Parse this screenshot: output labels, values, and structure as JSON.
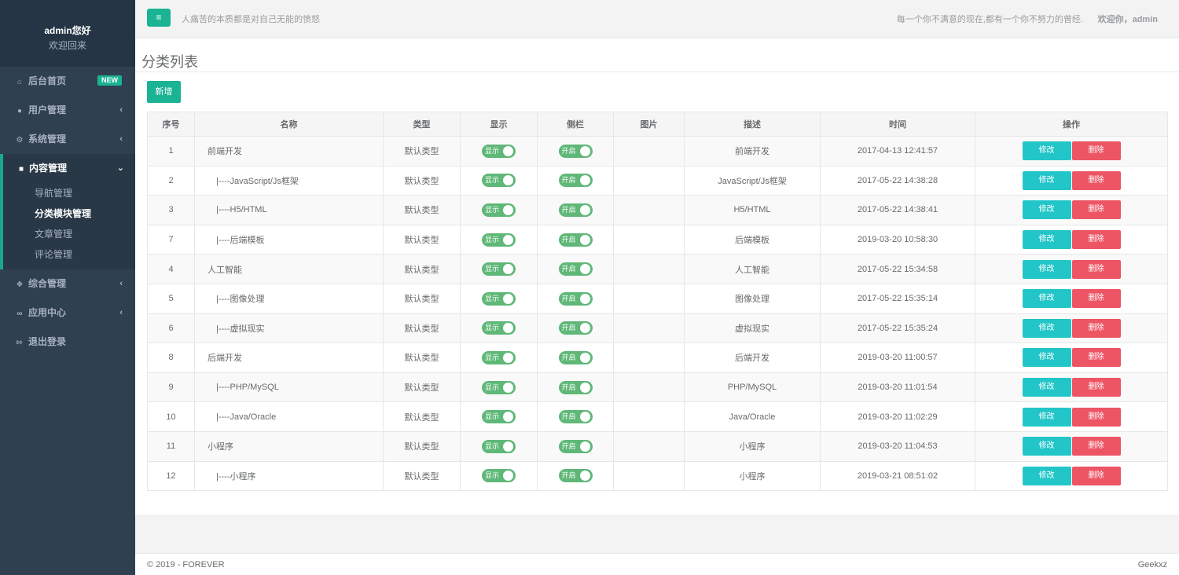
{
  "profile": {
    "name": "admin您好",
    "welcome": "欢迎回来"
  },
  "nav": {
    "items_top": [
      {
        "label": "后台首页",
        "icon": "home-icon",
        "badge": "NEW"
      },
      {
        "label": "用户管理",
        "icon": "user-icon",
        "arrow": "‹"
      },
      {
        "label": "系统管理",
        "icon": "gears-icon",
        "arrow": "‹"
      }
    ],
    "active": {
      "label": "内容管理",
      "icon": "document-icon",
      "arrow": "⌄",
      "sub": [
        "导航管理",
        "分类模块管理",
        "文章管理",
        "评论管理"
      ]
    },
    "items_bottom": [
      {
        "label": "综合管理",
        "icon": "cubes-icon",
        "arrow": "‹"
      },
      {
        "label": "应用中心",
        "icon": "link-icon",
        "arrow": "‹"
      },
      {
        "label": "退出登录",
        "icon": "logout-icon"
      }
    ]
  },
  "topbar": {
    "menu_icon": "≡",
    "slogan": "人痛苦的本质都是对自己无能的愤怒",
    "motto": "每一个你不满意的现在,都有一个你不努力的曾经.",
    "welcome": "欢迎你，admin"
  },
  "page": {
    "title": "分类列表",
    "add_label": "新增"
  },
  "table": {
    "headers": [
      "序号",
      "名称",
      "类型",
      "显示",
      "侧栏",
      "图片",
      "描述",
      "时间",
      "操作"
    ],
    "show_label": "显示",
    "sidebar_label": "开启",
    "edit_label": "修改",
    "delete_label": "删除",
    "rows": [
      {
        "id": "1",
        "name": "前端开发",
        "type": "默认类型",
        "desc": "前端开发",
        "time": "2017-04-13 12:41:57"
      },
      {
        "id": "2",
        "name": "|----JavaScript/Js框架",
        "type": "默认类型",
        "desc": "JavaScript/Js框架",
        "time": "2017-05-22 14:38:28"
      },
      {
        "id": "3",
        "name": "|----H5/HTML",
        "type": "默认类型",
        "desc": "H5/HTML",
        "time": "2017-05-22 14:38:41"
      },
      {
        "id": "7",
        "name": "|----后端模板",
        "type": "默认类型",
        "desc": "后端模板",
        "time": "2019-03-20 10:58:30"
      },
      {
        "id": "4",
        "name": "人工智能",
        "type": "默认类型",
        "desc": "人工智能",
        "time": "2017-05-22 15:34:58"
      },
      {
        "id": "5",
        "name": "|----图像处理",
        "type": "默认类型",
        "desc": "图像处理",
        "time": "2017-05-22 15:35:14"
      },
      {
        "id": "6",
        "name": "|----虚拟现实",
        "type": "默认类型",
        "desc": "虚拟现实",
        "time": "2017-05-22 15:35:24"
      },
      {
        "id": "8",
        "name": "后端开发",
        "type": "默认类型",
        "desc": "后端开发",
        "time": "2019-03-20 11:00:57"
      },
      {
        "id": "9",
        "name": "|----PHP/MySQL",
        "type": "默认类型",
        "desc": "PHP/MySQL",
        "time": "2019-03-20 11:01:54"
      },
      {
        "id": "10",
        "name": "|----Java/Oracle",
        "type": "默认类型",
        "desc": "Java/Oracle",
        "time": "2019-03-20 11:02:29"
      },
      {
        "id": "11",
        "name": "小程序",
        "type": "默认类型",
        "desc": "小程序",
        "time": "2019-03-20 11:04:53"
      },
      {
        "id": "12",
        "name": "|----小程序",
        "type": "默认类型",
        "desc": "小程序",
        "time": "2019-03-21 08:51:02"
      }
    ]
  },
  "footer": {
    "copyright": "© 2019 - FOREVER",
    "author": "Geekxz"
  }
}
